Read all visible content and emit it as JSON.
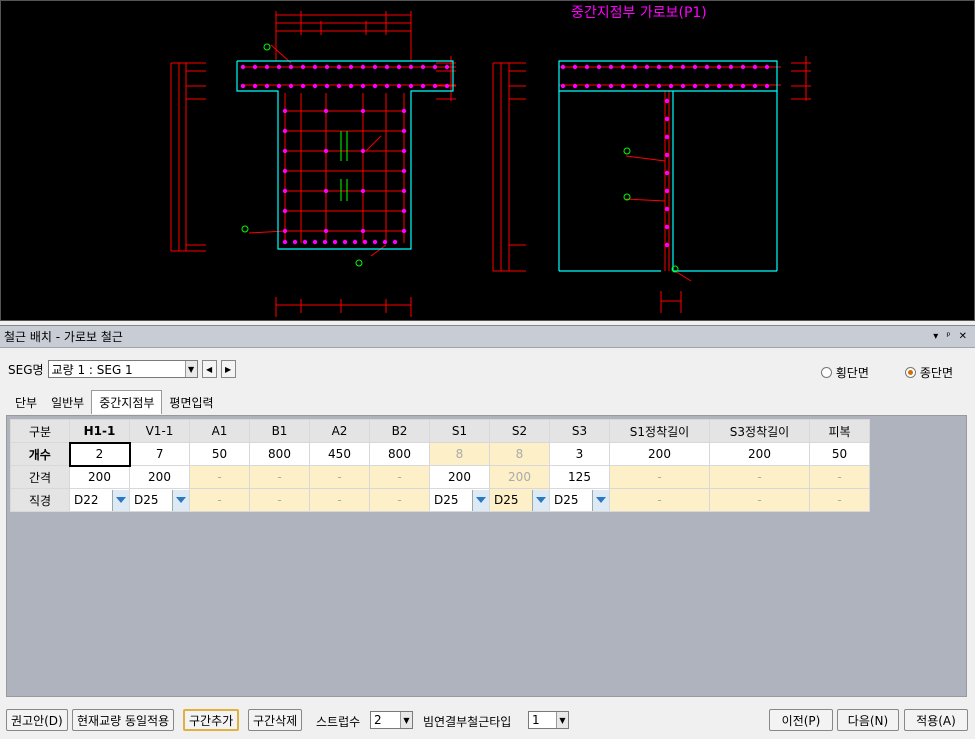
{
  "drawing": {
    "title": "중간지점부 가로보(P1)"
  },
  "panel": {
    "title": "철근 배치 - 가로보 철근",
    "title_buttons": [
      "▾",
      "ᵖ",
      "✕"
    ]
  },
  "seg": {
    "label": "SEG명",
    "value": "교량 1 : SEG 1"
  },
  "view_options": {
    "horizontal": "횡단면",
    "longitudinal": "종단면",
    "selected": "longitudinal"
  },
  "tabs": [
    {
      "label": "단부",
      "active": false
    },
    {
      "label": "일반부",
      "active": false
    },
    {
      "label": "중간지점부",
      "active": true
    },
    {
      "label": "평면입력",
      "active": false
    }
  ],
  "grid": {
    "corner": "구분",
    "columns": [
      "H1-1",
      "V1-1",
      "A1",
      "B1",
      "A2",
      "B2",
      "S1",
      "S2",
      "S3",
      "S1정착길이",
      "S3정착길이",
      "피복"
    ],
    "rows": [
      {
        "label": "개수",
        "cells": [
          "2",
          "7",
          "50",
          "800",
          "450",
          "800",
          "8",
          "8",
          "3",
          "200",
          "200",
          "50"
        ]
      },
      {
        "label": "간격",
        "cells": [
          "200",
          "200",
          "-",
          "-",
          "-",
          "-",
          "200",
          "200",
          "125",
          "-",
          "-",
          "-"
        ]
      },
      {
        "label": "직경",
        "cells": [
          "D22",
          "D25",
          "-",
          "-",
          "-",
          "-",
          "D25",
          "D25",
          "D25",
          "-",
          "-",
          "-"
        ]
      }
    ]
  },
  "footer": {
    "recommend": "권고안(D)",
    "apply_same": "현재교량 동일적용",
    "add_section": "구간추가",
    "delete_section": "구간삭제",
    "stirrup_label": "스트럽수",
    "stirrup_value": "2",
    "bar_type_label": "빔연결부철근타입",
    "bar_type_value": "1",
    "prev": "이전(P)",
    "next": "다음(N)",
    "apply": "적용(A)"
  },
  "colors": {
    "cad_bg": "#000000",
    "concrete_outline": "#00ffff",
    "rebar": "#ff00ff",
    "dimension": "#ff0000",
    "annotation": "#00ff00",
    "title_text": "#ff00ff",
    "grid_yellow": "#fdf0c8",
    "grid_bg": "#afb3bd"
  }
}
